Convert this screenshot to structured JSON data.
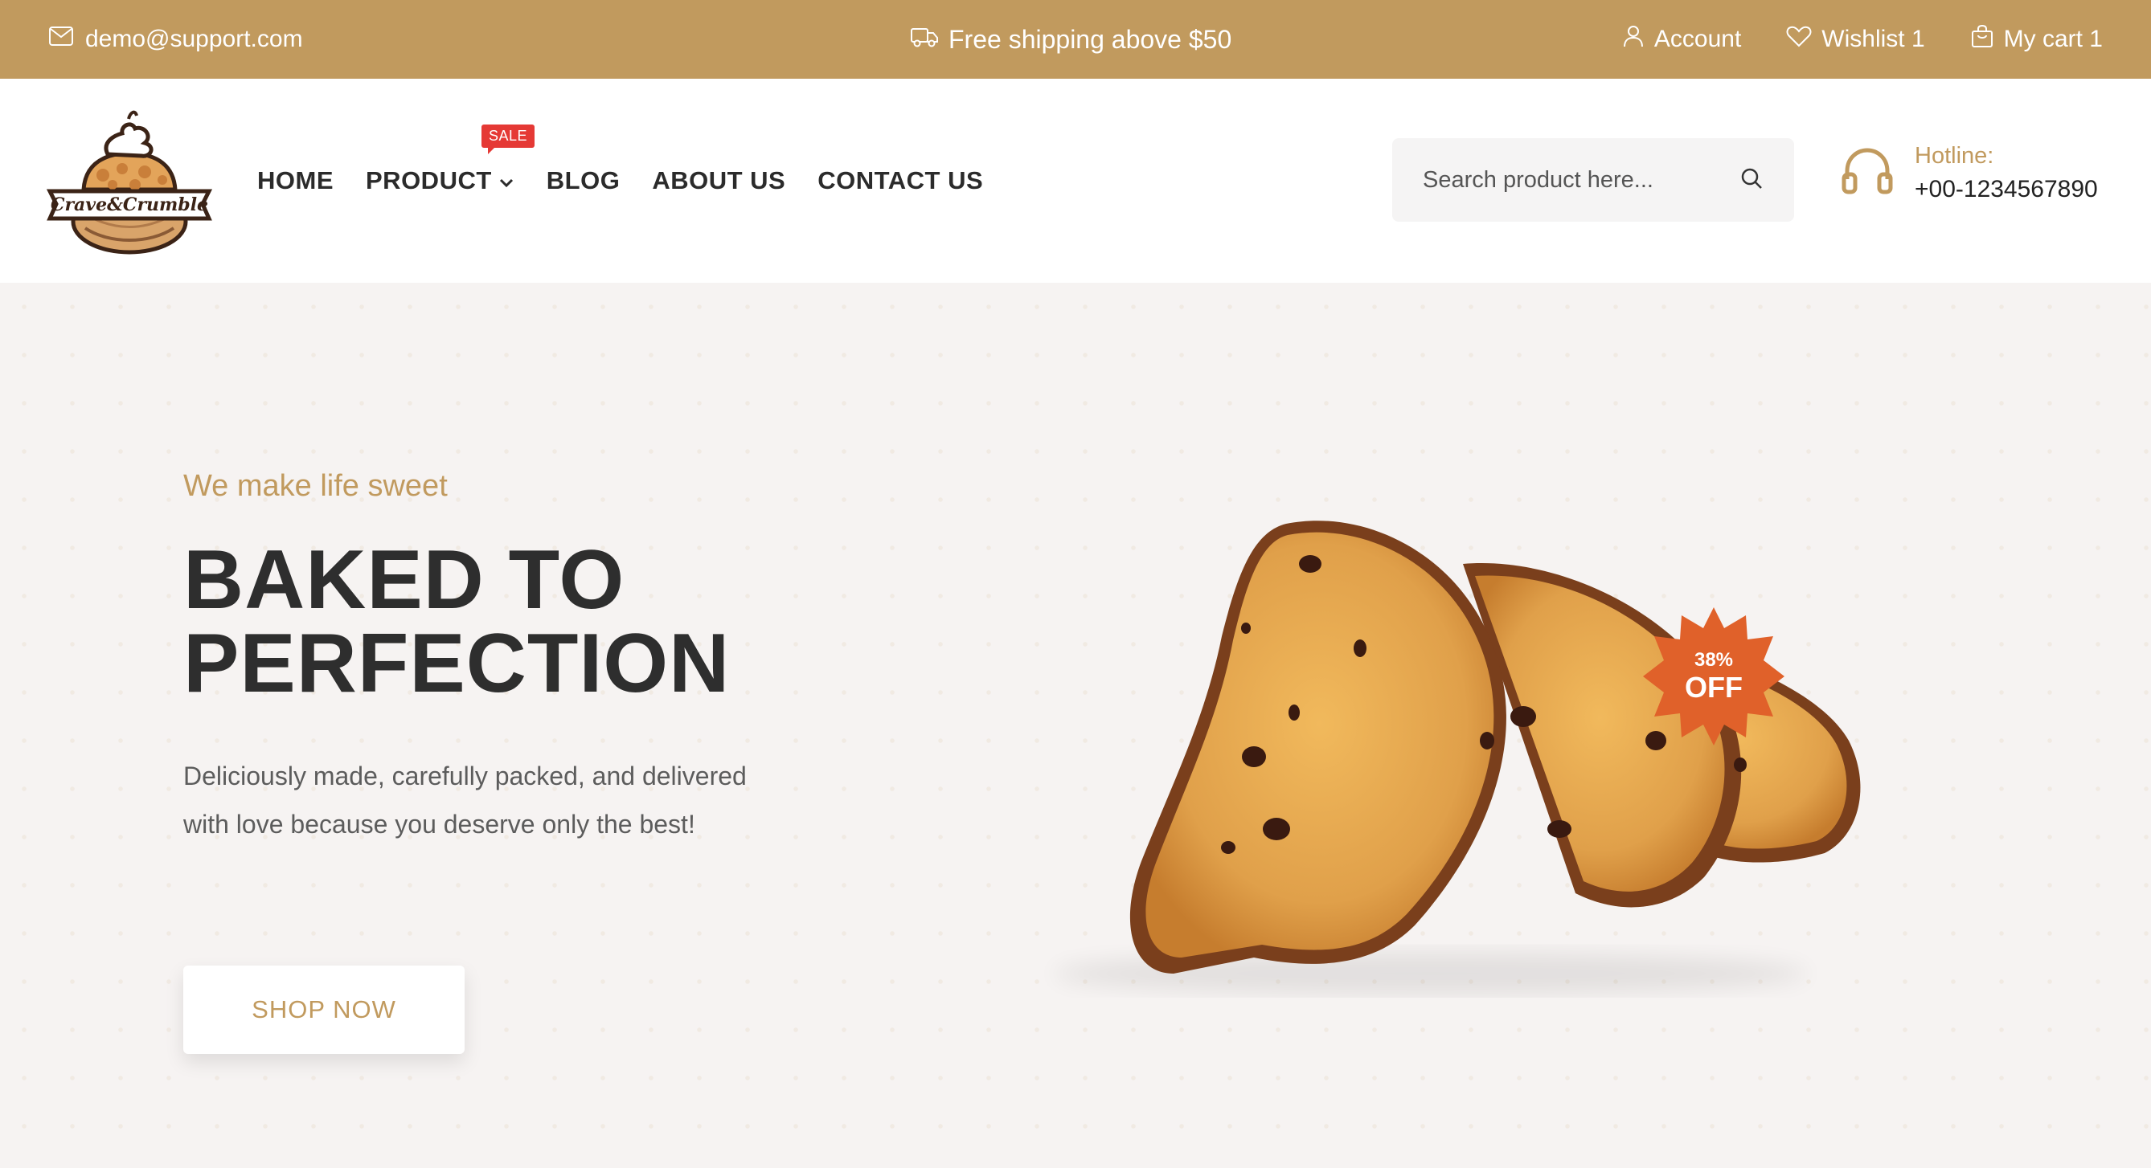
{
  "topbar": {
    "email": "demo@support.com",
    "shipping": "Free shipping above $50",
    "account": "Account",
    "wishlist": "Wishlist 1",
    "cart": "My cart 1"
  },
  "header": {
    "logo": {
      "line1": "Crave&Crumble"
    },
    "nav": {
      "home": "HOME",
      "product": "PRODUCT",
      "sale_badge": "SALE",
      "blog": "BLOG",
      "about": "ABOUT US",
      "contact": "CONTACT US"
    },
    "search": {
      "placeholder": "Search product here..."
    },
    "hotline": {
      "label": "Hotline:",
      "number": "+00-1234567890"
    }
  },
  "hero": {
    "tagline": "We make life sweet",
    "title_line1": "BAKED TO",
    "title_line2": "PERFECTION",
    "description": "Deliciously made, carefully packed, and delivered with love because you deserve only the best!",
    "cta": "SHOP NOW",
    "badge_percent": "38%",
    "badge_off": "OFF"
  },
  "colors": {
    "accent": "#c19a5e",
    "sale": "#e53935",
    "badge": "#e0612a",
    "hero_bg": "#f6f3f2"
  },
  "icons": [
    "mail-icon",
    "truck-icon",
    "user-icon",
    "heart-icon",
    "cart-icon",
    "chevron-down-icon",
    "search-icon",
    "headphones-icon"
  ]
}
